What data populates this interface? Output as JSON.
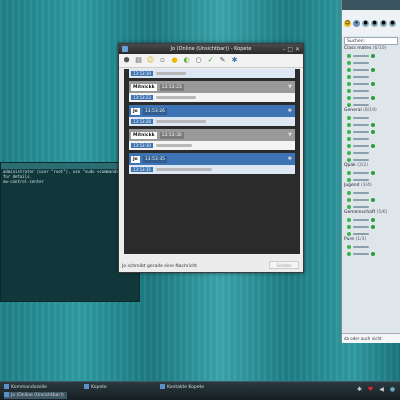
{
  "colors": {
    "accent_blue": "#3e74b3",
    "online_green": "#3cb44b",
    "desktop_teal": "#2d9aa2"
  },
  "terminal": {
    "lines": [
      "administrator (user \"root\"), use \"sudo <command>\"",
      "for details.",
      "",
      "",
      "ew-control-center"
    ]
  },
  "chat": {
    "title": "Jo (Online (Unsichtbar)) - Kopete",
    "toolbar_icons": [
      "send-icon",
      "contacts-icon",
      "smiley-icon",
      "bold-icon",
      "italic-icon",
      "color-icon",
      "spell-icon",
      "settings-icon"
    ],
    "messages": [
      {
        "type": "me",
        "name": "",
        "time": "13:53:19",
        "sub_time": "13:53:19"
      },
      {
        "type": "them",
        "name": "Mitnickk",
        "time": "13:53:23",
        "sub_time": "13:53:23"
      },
      {
        "type": "me",
        "name": "Jo",
        "time": "13:53:26",
        "sub_time": "13:53:28"
      },
      {
        "type": "them",
        "name": "Mitnickk",
        "time": "13:53:30",
        "sub_time": "13:53:30"
      },
      {
        "type": "me",
        "name": "Jo",
        "time": "13:53:35",
        "sub_time": "13:53:35"
      }
    ],
    "status_text": "Jo schreibt gerade eine Nachricht",
    "send_label": "Senden"
  },
  "roster": {
    "search_label": "Suchen:",
    "groups": [
      {
        "name": "Class mates",
        "count": "(6/10)",
        "contacts": 10
      },
      {
        "name": "General",
        "count": "(8/19)",
        "contacts": 8
      },
      {
        "name": "Qpak",
        "count": "(2/2)",
        "contacts": 2
      },
      {
        "name": "Jugend",
        "count": "(3/4)",
        "contacts": 3
      },
      {
        "name": "Gemeinschaft",
        "count": "(5/6)",
        "contacts": 5
      },
      {
        "name": "Pure",
        "count": "(1/3)",
        "contacts": 2
      }
    ],
    "status_text": "da oder auch nicht"
  },
  "taskbar": {
    "tasks": [
      "Kommandozeile",
      "Kopete",
      "Kontakte Kopete",
      "Jo (Online (Unsichtbar))"
    ]
  }
}
